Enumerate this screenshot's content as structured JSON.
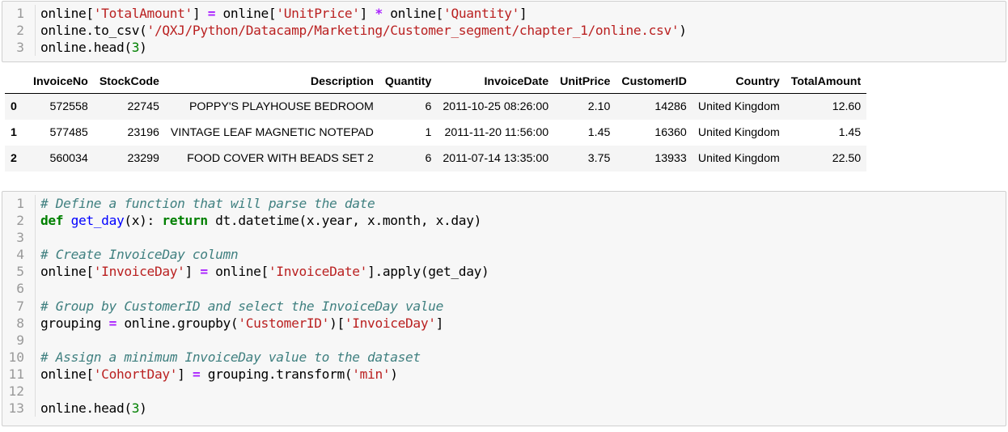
{
  "cell1": {
    "lines": [
      {
        "n": "1",
        "parts": [
          [
            "",
            "online["
          ],
          [
            "str",
            "'TotalAmount'"
          ],
          [
            "",
            "] "
          ],
          [
            "op",
            "="
          ],
          [
            "",
            " online["
          ],
          [
            "str",
            "'UnitPrice'"
          ],
          [
            "",
            "] "
          ],
          [
            "op",
            "*"
          ],
          [
            "",
            " online["
          ],
          [
            "str",
            "'Quantity'"
          ],
          [
            "",
            "]"
          ]
        ]
      },
      {
        "n": "2",
        "parts": [
          [
            "",
            "online.to_csv("
          ],
          [
            "str",
            "'/QXJ/Python/Datacamp/Marketing/Customer_segment/chapter_1/online.csv'"
          ],
          [
            "",
            ")"
          ]
        ]
      },
      {
        "n": "3",
        "parts": [
          [
            "",
            "online.head("
          ],
          [
            "num",
            "3"
          ],
          [
            "",
            ")"
          ]
        ]
      }
    ]
  },
  "table": {
    "columns": [
      "",
      "InvoiceNo",
      "StockCode",
      "Description",
      "Quantity",
      "InvoiceDate",
      "UnitPrice",
      "CustomerID",
      "Country",
      "TotalAmount"
    ],
    "rows": [
      [
        "0",
        "572558",
        "22745",
        "POPPY'S PLAYHOUSE BEDROOM",
        "6",
        "2011-10-25 08:26:00",
        "2.10",
        "14286",
        "United Kingdom",
        "12.60"
      ],
      [
        "1",
        "577485",
        "23196",
        "VINTAGE LEAF MAGNETIC NOTEPAD",
        "1",
        "2011-11-20 11:56:00",
        "1.45",
        "16360",
        "United Kingdom",
        "1.45"
      ],
      [
        "2",
        "560034",
        "23299",
        "FOOD COVER WITH BEADS SET 2",
        "6",
        "2011-07-14 13:35:00",
        "3.75",
        "13933",
        "United Kingdom",
        "22.50"
      ]
    ]
  },
  "cell2": {
    "lines": [
      {
        "n": "1",
        "parts": [
          [
            "cm",
            "# Define a function that will parse the date"
          ]
        ]
      },
      {
        "n": "2",
        "parts": [
          [
            "kw",
            "def"
          ],
          [
            "",
            " "
          ],
          [
            "fn",
            "get_day"
          ],
          [
            "",
            "(x): "
          ],
          [
            "kw",
            "return"
          ],
          [
            "",
            " dt.datetime(x.year, x.month, x.day)"
          ]
        ]
      },
      {
        "n": "3",
        "parts": []
      },
      {
        "n": "4",
        "parts": [
          [
            "cm",
            "# Create InvoiceDay column"
          ]
        ]
      },
      {
        "n": "5",
        "parts": [
          [
            "",
            "online["
          ],
          [
            "str",
            "'InvoiceDay'"
          ],
          [
            "",
            "] "
          ],
          [
            "op",
            "="
          ],
          [
            "",
            " online["
          ],
          [
            "str",
            "'InvoiceDate'"
          ],
          [
            "",
            "].apply(get_day)"
          ]
        ]
      },
      {
        "n": "6",
        "parts": []
      },
      {
        "n": "7",
        "parts": [
          [
            "cm",
            "# Group by CustomerID and select the InvoiceDay value"
          ]
        ]
      },
      {
        "n": "8",
        "parts": [
          [
            "",
            "grouping "
          ],
          [
            "op",
            "="
          ],
          [
            "",
            " online.groupby("
          ],
          [
            "str",
            "'CustomerID'"
          ],
          [
            "",
            ")["
          ],
          [
            "str",
            "'InvoiceDay'"
          ],
          [
            "",
            "]"
          ]
        ]
      },
      {
        "n": "9",
        "parts": []
      },
      {
        "n": "10",
        "parts": [
          [
            "cm",
            "# Assign a minimum InvoiceDay value to the dataset"
          ]
        ]
      },
      {
        "n": "11",
        "parts": [
          [
            "",
            "online["
          ],
          [
            "str",
            "'CohortDay'"
          ],
          [
            "",
            "] "
          ],
          [
            "op",
            "="
          ],
          [
            "",
            " grouping.transform("
          ],
          [
            "str",
            "'min'"
          ],
          [
            "",
            ")"
          ]
        ]
      },
      {
        "n": "12",
        "parts": []
      },
      {
        "n": "13",
        "parts": [
          [
            "",
            "online.head("
          ],
          [
            "num",
            "3"
          ],
          [
            "",
            ")"
          ]
        ]
      }
    ]
  }
}
